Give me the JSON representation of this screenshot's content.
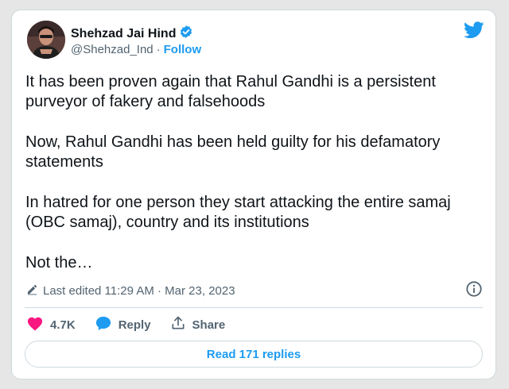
{
  "author": {
    "name": "Shehzad Jai Hind",
    "handle": "@Shehzad_Ind",
    "separator": "·",
    "follow_label": "Follow"
  },
  "tweet": {
    "paragraphs": [
      "It has been proven again that Rahul Gandhi is a persistent purveyor of fakery and falsehoods",
      "Now, Rahul Gandhi has been held guilty for his defamatory statements",
      "In hatred for one person they start attacking the entire samaj (OBC samaj), country and its institutions",
      "Not the…"
    ]
  },
  "meta": {
    "edited_text": "Last edited 11:29 AM · Mar 23, 2023"
  },
  "actions": {
    "like_count": "4.7K",
    "reply_label": "Reply",
    "share_label": "Share"
  },
  "replies_button": "Read 171 replies",
  "colors": {
    "accent": "#1d9bf0",
    "like": "#f91880",
    "verified": "#1d9bf0",
    "text_primary": "#0f1419",
    "text_secondary": "#536471",
    "border": "#cfd9de"
  },
  "icons": {
    "logo": "twitter-bird-icon",
    "verified": "verified-badge-icon",
    "edit": "pencil-icon",
    "info": "info-icon",
    "like": "heart-icon",
    "reply": "speech-bubble-icon",
    "share": "share-upload-icon"
  }
}
